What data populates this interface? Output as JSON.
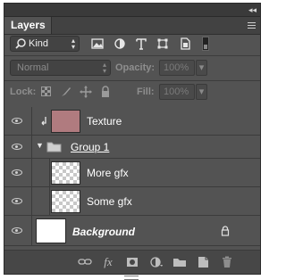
{
  "panel": {
    "collapse_glyph": "◂◂",
    "tab_label": "Layers",
    "tab_close_glyph": "✕"
  },
  "filter": {
    "kind_label": "Kind",
    "kind_icon": "search-icon",
    "icons": [
      "image-layer-filter-icon",
      "adjustment-layer-filter-icon",
      "type-layer-filter-icon",
      "shape-layer-filter-icon",
      "smart-object-filter-icon"
    ],
    "toggle": "filter-toggle"
  },
  "blend": {
    "mode": "Normal",
    "opacity_label": "Opacity:",
    "opacity_value": "100%"
  },
  "lock": {
    "label": "Lock:",
    "fill_label": "Fill:",
    "fill_value": "100%"
  },
  "layers": [
    {
      "name": "Texture",
      "type": "clipped",
      "thumb_color": "#b07b7f",
      "visible": true
    },
    {
      "name": "Group 1",
      "type": "group",
      "expanded": true,
      "visible": true
    },
    {
      "name": "More gfx",
      "type": "transparent",
      "visible": true
    },
    {
      "name": "Some gfx",
      "type": "transparent",
      "visible": true
    },
    {
      "name": "Background",
      "type": "background",
      "thumb_color": "#ffffff",
      "locked": true,
      "visible": true
    }
  ],
  "footer_buttons": [
    "link-layers-icon",
    "fx-icon",
    "add-mask-icon",
    "new-adjustment-layer-icon",
    "new-group-icon",
    "new-layer-icon",
    "delete-layer-icon"
  ],
  "footer_fx": "fx"
}
